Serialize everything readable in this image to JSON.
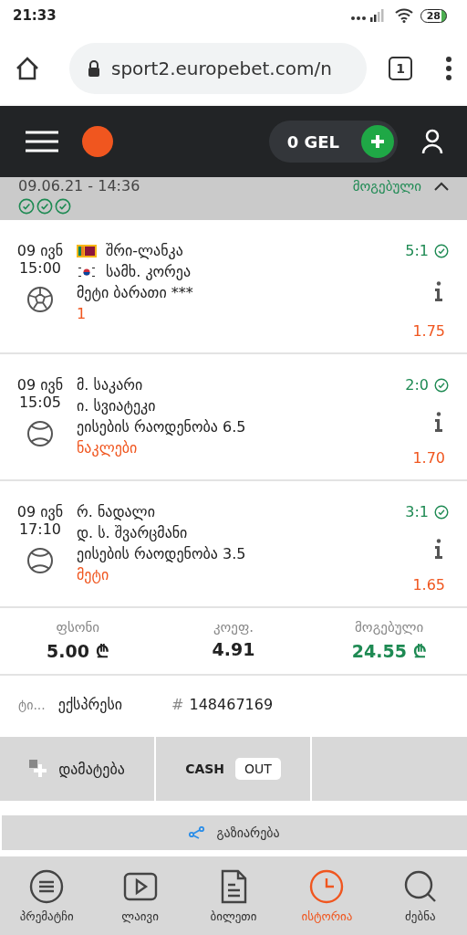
{
  "status_bar": {
    "time": "21:33",
    "battery": "28"
  },
  "browser": {
    "url": "sport2.europebet.com/n",
    "tab_count": "1"
  },
  "header": {
    "balance": "0 GEL"
  },
  "bet": {
    "date": "09.06.21 - 14:36",
    "status": "მოგებული",
    "expanded": true
  },
  "events": [
    {
      "day": "09 ივნ",
      "time": "15:00",
      "kind": "football",
      "teams": [
        {
          "name": "შრი-ლანკა",
          "kind": "lk"
        },
        {
          "name": "სამხ. კორეა",
          "kind": "kr"
        }
      ],
      "market": "მეტი ბარათი ***",
      "pick": "1",
      "score": "5:1",
      "won": true,
      "odds": "1.75"
    },
    {
      "day": "09 ივნ",
      "time": "15:05",
      "kind": "tennis",
      "teams": [
        {
          "name": "მ. საკარი"
        },
        {
          "name": "ი. სვიატეკი"
        }
      ],
      "market": "ეისების რაოდენობა 6.5",
      "pick": "ნაკლები",
      "score": "2:0",
      "won": true,
      "odds": "1.70"
    },
    {
      "day": "09 ივნ",
      "time": "17:10",
      "kind": "tennis",
      "teams": [
        {
          "name": "რ. ნადალი"
        },
        {
          "name": "დ. ს. შვარცმანი"
        }
      ],
      "market": "ეისების რაოდენობა 3.5",
      "pick": "მეტი",
      "score": "3:1",
      "won": true,
      "odds": "1.65"
    }
  ],
  "summary": [
    {
      "label": "ფსონი",
      "value": "5.00 ₾",
      "highlight": false
    },
    {
      "label": "კოეფ.",
      "value": "4.91",
      "highlight": false
    },
    {
      "label": "მოგებული",
      "value": "24.55 ₾",
      "highlight": true
    }
  ],
  "ticket": {
    "type_label": "ტი...",
    "type": "ექსპრესი",
    "hash": "#",
    "number": "148467169"
  },
  "actions": {
    "add": "დამატება",
    "cash": "CASH",
    "out": "OUT"
  },
  "share": "გაზიარება",
  "nav": [
    {
      "label": "პრემატჩი",
      "kind": "list",
      "selected": false
    },
    {
      "label": "ლაივი",
      "kind": "play",
      "selected": false
    },
    {
      "label": "ბილეთი",
      "kind": "doc",
      "selected": false
    },
    {
      "label": "ისტორია",
      "kind": "clock",
      "selected": true
    },
    {
      "label": "ძებნა",
      "kind": "search",
      "selected": false
    }
  ]
}
